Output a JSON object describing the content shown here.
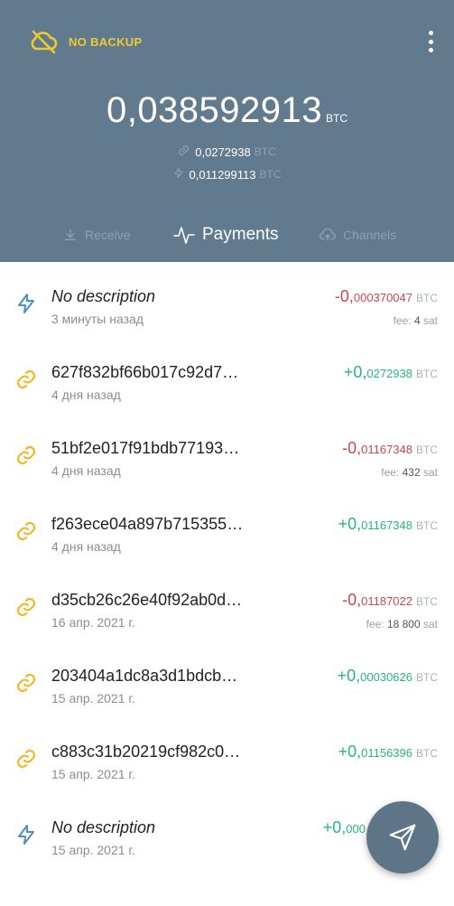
{
  "header": {
    "backup_label": "NO BACKUP",
    "balance_main": "0,",
    "balance_digits": "038592913",
    "balance_unit": "BTC",
    "onchain": {
      "prefix": "0,",
      "value": "0272938",
      "unit": "BTC"
    },
    "lightning": {
      "prefix": "0,",
      "value": "011299113",
      "unit": "BTC"
    },
    "colors": {
      "header_bg": "#627a8e",
      "backup": "#f0c930"
    }
  },
  "tabs": [
    {
      "label": "Receive",
      "icon": "download-icon",
      "active": false
    },
    {
      "label": "Payments",
      "icon": "pulse-icon",
      "active": true
    },
    {
      "label": "Channels",
      "icon": "cloud-upload-icon",
      "active": false
    }
  ],
  "payments": [
    {
      "type": "lightning",
      "title": "No description",
      "italic": true,
      "time": "3 минуты назад",
      "sign": "-",
      "int": "0,",
      "frac": "000370047",
      "unit": "BTC",
      "fee_label": "fee:",
      "fee_value": "4",
      "fee_unit": "sat"
    },
    {
      "type": "onchain",
      "title": "627f832bf66b017c92d7…",
      "italic": false,
      "time": "4 дня назад",
      "sign": "+",
      "int": "0,",
      "frac": "0272938",
      "unit": "BTC",
      "fee_label": "",
      "fee_value": "",
      "fee_unit": ""
    },
    {
      "type": "onchain",
      "title": "51bf2e017f91bdb77193…",
      "italic": false,
      "time": "4 дня назад",
      "sign": "-",
      "int": "0,",
      "frac": "01167348",
      "unit": "BTC",
      "fee_label": "fee:",
      "fee_value": "432",
      "fee_unit": "sat"
    },
    {
      "type": "onchain",
      "title": "f263ece04a897b715355…",
      "italic": false,
      "time": "4 дня назад",
      "sign": "+",
      "int": "0,",
      "frac": "01167348",
      "unit": "BTC",
      "fee_label": "",
      "fee_value": "",
      "fee_unit": ""
    },
    {
      "type": "onchain",
      "title": "d35cb26c26e40f92ab0d…",
      "italic": false,
      "time": "16 апр. 2021 г.",
      "sign": "-",
      "int": "0,",
      "frac": "01187022",
      "unit": "BTC",
      "fee_label": "fee:",
      "fee_value": "18 800",
      "fee_unit": "sat"
    },
    {
      "type": "onchain",
      "title": "203404a1dc8a3d1bdcb…",
      "italic": false,
      "time": "15 апр. 2021 г.",
      "sign": "+",
      "int": "0,",
      "frac": "00030626",
      "unit": "BTC",
      "fee_label": "",
      "fee_value": "",
      "fee_unit": ""
    },
    {
      "type": "onchain",
      "title": "c883c31b20219cf982c0…",
      "italic": false,
      "time": "15 апр. 2021 г.",
      "sign": "+",
      "int": "0,",
      "frac": "01156396",
      "unit": "BTC",
      "fee_label": "",
      "fee_value": "",
      "fee_unit": ""
    },
    {
      "type": "lightning",
      "title": "No description",
      "italic": true,
      "time": "15 апр. 2021 г.",
      "sign": "+",
      "int": "0,",
      "frac": "000",
      "unit": "",
      "fee_label": "",
      "fee_value": "",
      "fee_unit": ""
    }
  ],
  "fab": {
    "icon": "send-icon"
  }
}
